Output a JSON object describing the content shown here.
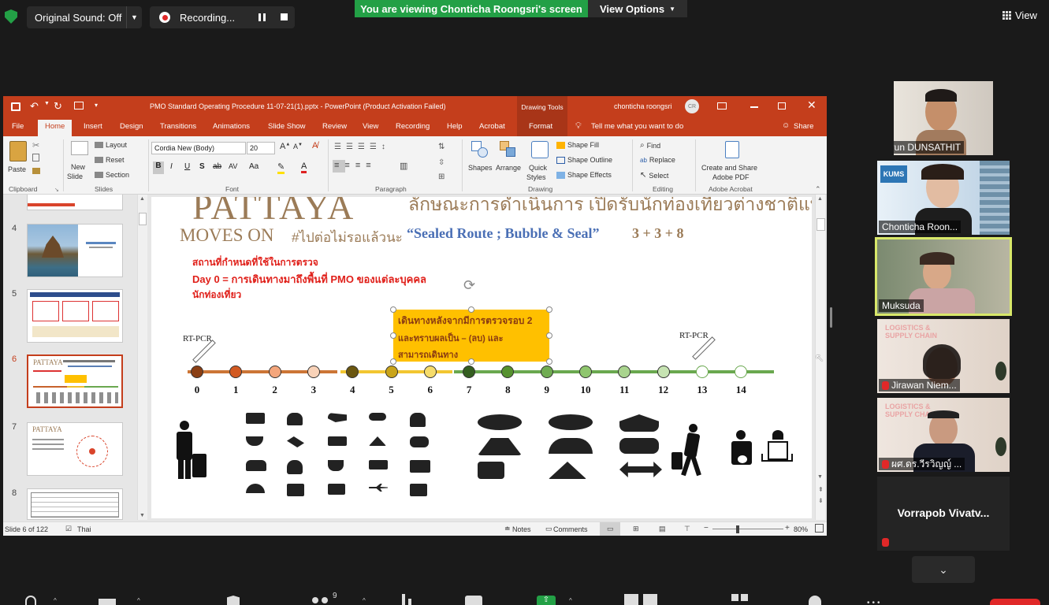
{
  "zoom": {
    "original_sound": "Original Sound: Off",
    "recording": "Recording...",
    "banner": "You are viewing Chonticha Roongsri's screen",
    "view_options": "View Options",
    "view": "View"
  },
  "ppt": {
    "title": "PMO Standard Operating Procedure 11-07-21(1).pptx  -  PowerPoint (Product Activation Failed)",
    "drawing_tools": "Drawing Tools",
    "user": "chonticha roongsri",
    "user_initials": "CR",
    "tabs": [
      "File",
      "Home",
      "Insert",
      "Design",
      "Transitions",
      "Animations",
      "Slide Show",
      "Review",
      "View",
      "Recording",
      "Help",
      "Acrobat",
      "Format"
    ],
    "tell_me": "Tell me what you want to do",
    "share": "Share",
    "ribbon": {
      "paste": "Paste",
      "new_slide_1": "New",
      "new_slide_2": "Slide",
      "layout": "Layout",
      "reset": "Reset",
      "section": "Section",
      "font_name": "Cordia New (Body)",
      "font_size": "20",
      "shapes": "Shapes",
      "arrange": "Arrange",
      "quick_1": "Quick",
      "quick_2": "Styles",
      "shape_fill": "Shape Fill",
      "shape_outline": "Shape Outline",
      "shape_effects": "Shape Effects",
      "find": "Find",
      "replace": "Replace",
      "select": "Select",
      "adobe_1": "Create and Share",
      "adobe_2": "Adobe PDF",
      "groups": [
        "Clipboard",
        "Slides",
        "Font",
        "Paragraph",
        "Drawing",
        "Editing",
        "Adobe Acrobat"
      ]
    },
    "thumb_numbers": [
      "4",
      "5",
      "6",
      "7",
      "8"
    ],
    "slide": {
      "title_big": "PATTAYA",
      "title_right": "ลักษณะการดำเนินการ เปิดรับนักท่องเที่ยวต่างชาติแบบ",
      "moves_on": "MOVES ON",
      "hashtag": "#ไปต่อไม่รอแล้วนะ",
      "sealed_route": "“Sealed Route ; Bubble & Seal”",
      "formula": "3 + 3 + 8",
      "red1": "สถานที่กำหนดที่ใช้ในการตรวจ",
      "red2": "Day 0 = การเดินทางมาถึงพื้นที่ PMO ของแต่ละบุคคล",
      "red3": "นักท่องเที่ยว",
      "box1": "เดินทางหลังจากมีการตรวจรอบ 2",
      "box2": "และทราบผลเป็น – (ลบ) และ",
      "box3": "สามารถเดินทาง",
      "rtpcr_left": "RT-PCR",
      "rtpcr_right": "RT-PCR",
      "days": [
        "0",
        "1",
        "2",
        "3",
        "4",
        "5",
        "6",
        "7",
        "8",
        "9",
        "10",
        "11",
        "12",
        "13",
        "14"
      ]
    },
    "status": {
      "slide_of": "Slide 6 of 122",
      "language": "Thai",
      "notes": "Notes",
      "comments": "Comments",
      "zoom": "80%"
    }
  },
  "participants": [
    {
      "name": "sarun DUNSATHIT"
    },
    {
      "name": "Chonticha Roon..."
    },
    {
      "name": "Muksuda"
    },
    {
      "name": "Jirawan Niem..."
    },
    {
      "name": "ผศ.ดร.วีรวิญญ์ ..."
    },
    {
      "name": "Vorrapob  Vivatv..."
    }
  ],
  "toolbar": {
    "participants_count": "9"
  },
  "colors": {
    "ppt_red": "#c43e1c",
    "zoom_green": "#23a046",
    "active_speaker": "#d8e86a"
  }
}
